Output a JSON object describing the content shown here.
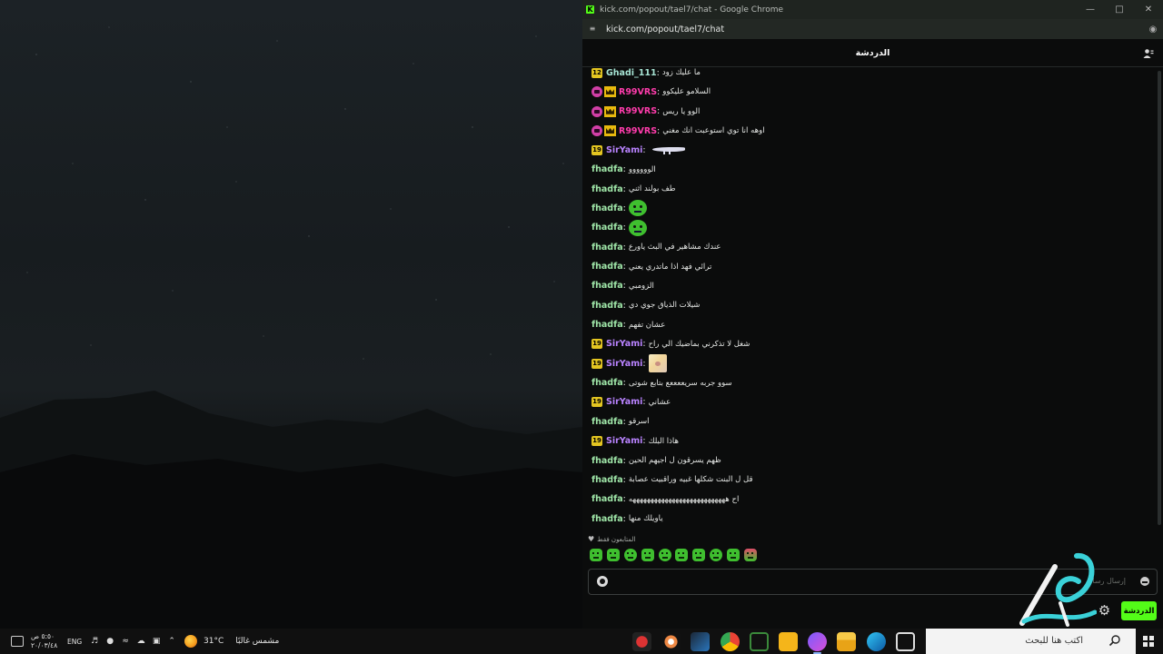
{
  "window": {
    "title": "kick.com/popout/tael7/chat - Google Chrome",
    "url": "kick.com/popout/tael7/chat",
    "favicon_letter": "K"
  },
  "chat": {
    "header_title": "الدردشة",
    "messages": [
      {
        "user": "Ghadi_111",
        "user_color": "#a6e3d3",
        "badges": [
          "sub"
        ],
        "sub_months": "12",
        "text": "ما عليك زود",
        "emote": ""
      },
      {
        "user": "R99VRS",
        "user_color": "#ff3cac",
        "badges": [
          "og",
          "crown"
        ],
        "sub_months": "",
        "text": "السلامو عليكوو",
        "emote": ""
      },
      {
        "user": "R99VRS",
        "user_color": "#ff3cac",
        "badges": [
          "og",
          "crown"
        ],
        "sub_months": "",
        "text": "الوو يا ريس",
        "emote": ""
      },
      {
        "user": "R99VRS",
        "user_color": "#ff3cac",
        "badges": [
          "og",
          "crown"
        ],
        "sub_months": "",
        "text": "اوهه انا توي استوعبت انك مغني",
        "emote": ""
      },
      {
        "user": "SirYami",
        "user_color": "#b983ff",
        "badges": [
          "sub"
        ],
        "sub_months": "19",
        "text": "",
        "emote": "dino"
      },
      {
        "user": "fhadfa",
        "user_color": "#9fe6a8",
        "badges": [],
        "sub_months": "",
        "text": "الوووووو",
        "emote": ""
      },
      {
        "user": "fhadfa",
        "user_color": "#9fe6a8",
        "badges": [],
        "sub_months": "",
        "text": "طف بولند اثني",
        "emote": ""
      },
      {
        "user": "fhadfa",
        "user_color": "#9fe6a8",
        "badges": [],
        "sub_months": "",
        "text": "",
        "emote": "green"
      },
      {
        "user": "fhadfa",
        "user_color": "#9fe6a8",
        "badges": [],
        "sub_months": "",
        "text": "",
        "emote": "green"
      },
      {
        "user": "fhadfa",
        "user_color": "#9fe6a8",
        "badges": [],
        "sub_months": "",
        "text": "عندك مشاهير في البث ياورع",
        "emote": ""
      },
      {
        "user": "fhadfa",
        "user_color": "#9fe6a8",
        "badges": [],
        "sub_months": "",
        "text": "ترائي فهد اذا ماتدري يعني",
        "emote": ""
      },
      {
        "user": "fhadfa",
        "user_color": "#9fe6a8",
        "badges": [],
        "sub_months": "",
        "text": "الزومبي",
        "emote": ""
      },
      {
        "user": "fhadfa",
        "user_color": "#9fe6a8",
        "badges": [],
        "sub_months": "",
        "text": "شيلات الذياق جوي دي",
        "emote": ""
      },
      {
        "user": "fhadfa",
        "user_color": "#9fe6a8",
        "badges": [],
        "sub_months": "",
        "text": "عشان تفهم",
        "emote": ""
      },
      {
        "user": "SirYami",
        "user_color": "#b983ff",
        "badges": [
          "sub"
        ],
        "sub_months": "19",
        "text": "شغل لا تذكرني بماضيك الي راح",
        "emote": ""
      },
      {
        "user": "SirYami",
        "user_color": "#b983ff",
        "badges": [
          "sub"
        ],
        "sub_months": "19",
        "text": "",
        "emote": "anime"
      },
      {
        "user": "fhadfa",
        "user_color": "#9fe6a8",
        "badges": [],
        "sub_months": "",
        "text": "سوو جربه سريععععع بتابع شوتى",
        "emote": ""
      },
      {
        "user": "SirYami",
        "user_color": "#b983ff",
        "badges": [
          "sub"
        ],
        "sub_months": "19",
        "text": "عشاني",
        "emote": ""
      },
      {
        "user": "fhadfa",
        "user_color": "#9fe6a8",
        "badges": [],
        "sub_months": "",
        "text": "اسرقو",
        "emote": ""
      },
      {
        "user": "SirYami",
        "user_color": "#b983ff",
        "badges": [
          "sub"
        ],
        "sub_months": "19",
        "text": "هاذا البلك",
        "emote": ""
      },
      {
        "user": "fhadfa",
        "user_color": "#9fe6a8",
        "badges": [],
        "sub_months": "",
        "text": "ظهم يسرقون ل اجيهم الحين",
        "emote": ""
      },
      {
        "user": "fhadfa",
        "user_color": "#9fe6a8",
        "badges": [],
        "sub_months": "",
        "text": "قل ل البنت شكلها غبيه وراقبيت عصابة",
        "emote": ""
      },
      {
        "user": "fhadfa",
        "user_color": "#9fe6a8",
        "badges": [],
        "sub_months": "",
        "text": "اح هههههههههههههههههههههههههههه",
        "emote": ""
      },
      {
        "user": "fhadfa",
        "user_color": "#9fe6a8",
        "badges": [],
        "sub_months": "",
        "text": "ياويلك منها",
        "emote": ""
      }
    ],
    "quick_emotes_label": "المتابعون فقط",
    "quick_emote_count": 10,
    "input_placeholder": "إرسال رسالة",
    "send_label": "الدردشة"
  },
  "taskbar": {
    "search_placeholder": "اكتب هنا للبحث",
    "weather_temp": "31°C",
    "weather_desc": "مشمس غالبًا",
    "language": "ENG",
    "time": "٥:٥٠ ص",
    "date": "٢٠/٠٣/٤٨"
  },
  "colors": {
    "kick_green": "#53fc18",
    "window_bg": "#0b0c0c",
    "sub_badge": "#e3c521"
  }
}
